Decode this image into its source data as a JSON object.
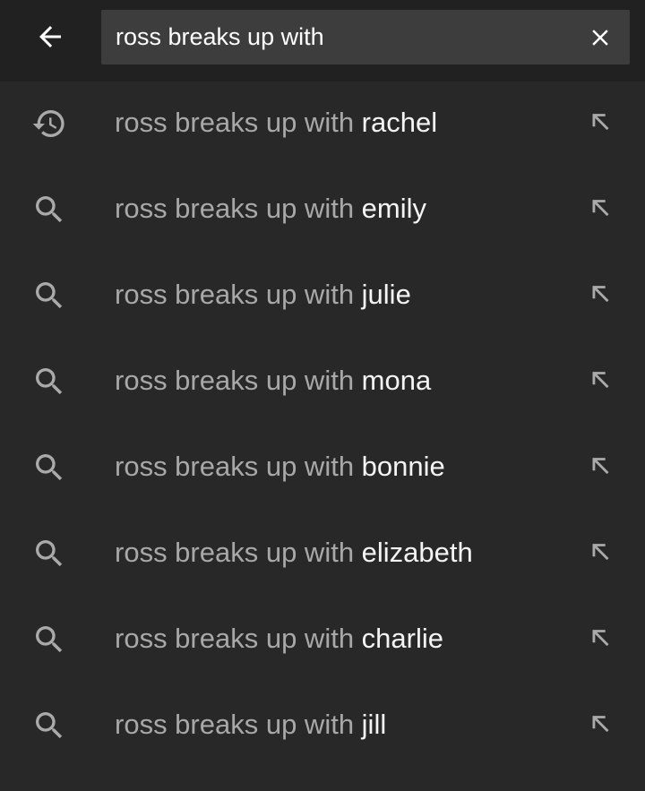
{
  "search": {
    "query": "ross breaks up with"
  },
  "icons": {
    "back": "arrow-left-icon",
    "clear": "close-icon",
    "history": "history-icon",
    "search": "search-icon",
    "fill": "arrow-up-left-icon"
  },
  "colors": {
    "background": "#282828",
    "topbar": "#212121",
    "search_box": "#3d3d3d",
    "prefix_text": "#a8a8a8",
    "suffix_text": "#f4f4f4",
    "icon": "#aaaaaa"
  },
  "suggestions": [
    {
      "prefix": "ross breaks up with ",
      "completion": "rachel",
      "icon": "history-icon"
    },
    {
      "prefix": "ross breaks up with ",
      "completion": "emily",
      "icon": "search-icon"
    },
    {
      "prefix": "ross breaks up with ",
      "completion": "julie",
      "icon": "search-icon"
    },
    {
      "prefix": "ross breaks up with ",
      "completion": "mona",
      "icon": "search-icon"
    },
    {
      "prefix": "ross breaks up with ",
      "completion": "bonnie",
      "icon": "search-icon"
    },
    {
      "prefix": "ross breaks up with ",
      "completion": "elizabeth",
      "icon": "search-icon"
    },
    {
      "prefix": "ross breaks up with ",
      "completion": "charlie",
      "icon": "search-icon"
    },
    {
      "prefix": "ross breaks up with ",
      "completion": "jill",
      "icon": "search-icon"
    }
  ]
}
